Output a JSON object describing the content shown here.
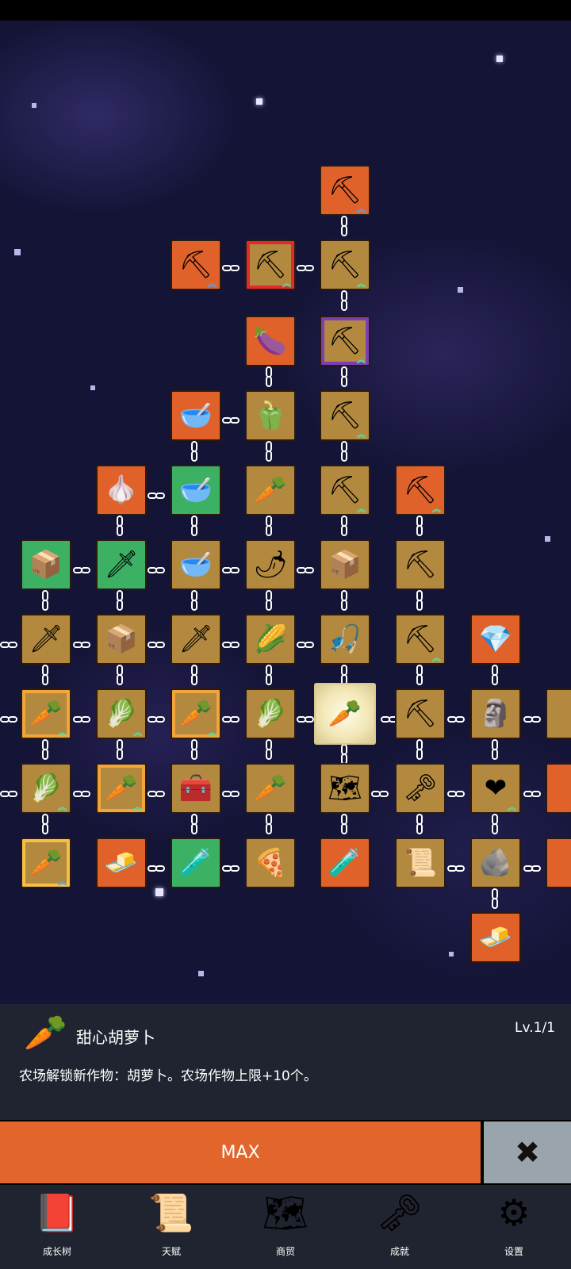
{
  "colors": {
    "space_bg": "#141436",
    "tile_gold": "#b3893f",
    "tile_orange": "#e0622a",
    "tile_green": "#3cb063",
    "panel_bg": "#1f2430",
    "max_button": "#e2652b",
    "close_button": "#9aa4ad"
  },
  "tree": {
    "nodes": [
      {
        "icon": "shovel-icon",
        "glyph": "⛏",
        "tile": "orange",
        "chev": "blue"
      },
      {
        "icon": "shovel-icon",
        "glyph": "⛏",
        "tile": "orange",
        "chev": "blue"
      },
      {
        "icon": "shovel-icon",
        "glyph": "⛏",
        "tile": "gold",
        "chev": "green",
        "frame": "red"
      },
      {
        "icon": "shovel-icon",
        "glyph": "⛏",
        "tile": "gold",
        "chev": "green"
      },
      {
        "icon": "eggplant-icon",
        "glyph": "🍆",
        "tile": "orange"
      },
      {
        "icon": "shovel-icon",
        "glyph": "⛏",
        "tile": "gold",
        "chev": "green",
        "frame": "purple"
      },
      {
        "icon": "bowl-icon",
        "glyph": "🥣",
        "tile": "orange"
      },
      {
        "icon": "pepper-icon",
        "glyph": "🫑",
        "tile": "gold"
      },
      {
        "icon": "shovel-icon",
        "glyph": "⛏",
        "tile": "gold",
        "chev": "green"
      },
      {
        "icon": "garlic-icon",
        "glyph": "🧄",
        "tile": "orange"
      },
      {
        "icon": "bowl-icon",
        "glyph": "🥣",
        "tile": "green"
      },
      {
        "icon": "radish-icon",
        "glyph": "🥕",
        "tile": "gold"
      },
      {
        "icon": "shovel-icon",
        "glyph": "⛏",
        "tile": "gold",
        "chev": "green"
      },
      {
        "icon": "pickaxe-icon",
        "glyph": "⛏",
        "tile": "orange",
        "chev": "green"
      },
      {
        "icon": "crate-icon",
        "glyph": "📦",
        "tile": "green"
      },
      {
        "icon": "sword-icon",
        "glyph": "🗡",
        "tile": "green"
      },
      {
        "icon": "bowl-icon",
        "glyph": "🥣",
        "tile": "gold"
      },
      {
        "icon": "chili-icon",
        "glyph": "🌶",
        "tile": "gold"
      },
      {
        "icon": "crate-icon",
        "glyph": "📦",
        "tile": "gold"
      },
      {
        "icon": "pickaxe-icon",
        "glyph": "⛏",
        "tile": "gold"
      },
      {
        "icon": "sword-icon",
        "glyph": "🗡",
        "tile": "gold"
      },
      {
        "icon": "crate-icon",
        "glyph": "📦",
        "tile": "gold"
      },
      {
        "icon": "sword-icon",
        "glyph": "🗡",
        "tile": "gold"
      },
      {
        "icon": "corn-icon",
        "glyph": "🌽",
        "tile": "gold"
      },
      {
        "icon": "fishing-rod-icon",
        "glyph": "🎣",
        "tile": "gold"
      },
      {
        "icon": "pickaxe-icon",
        "glyph": "⛏",
        "tile": "gold",
        "chev": "green"
      },
      {
        "icon": "crystal-icon",
        "glyph": "💎",
        "tile": "orange"
      },
      {
        "icon": "carrot-icon",
        "glyph": "🥕",
        "tile": "gold",
        "chev": "green",
        "frame": "orange"
      },
      {
        "icon": "cabbage-icon",
        "glyph": "🥬",
        "tile": "gold",
        "chev": "green"
      },
      {
        "icon": "carrot-icon",
        "glyph": "🥕",
        "tile": "gold",
        "chev": "green",
        "frame": "orange"
      },
      {
        "icon": "cabbage-icon",
        "glyph": "🥬",
        "tile": "gold"
      },
      {
        "icon": "carrot-icon",
        "glyph": "🥕",
        "tile": "sel"
      },
      {
        "icon": "pickaxe-icon",
        "glyph": "⛏",
        "tile": "gold"
      },
      {
        "icon": "statue-icon",
        "glyph": "🗿",
        "tile": "gold"
      },
      {
        "icon": "cabbage-icon",
        "glyph": "🥬",
        "tile": "gold",
        "chev": "green"
      },
      {
        "icon": "carrot-icon",
        "glyph": "🥕",
        "tile": "gold",
        "chev": "green",
        "frame": "orange"
      },
      {
        "icon": "chest-icon",
        "glyph": "🧰",
        "tile": "gold"
      },
      {
        "icon": "parsnip-icon",
        "glyph": "🥕",
        "tile": "gold"
      },
      {
        "icon": "map-icon",
        "glyph": "🗺",
        "tile": "gold"
      },
      {
        "icon": "key-icon",
        "glyph": "🗝",
        "tile": "gold"
      },
      {
        "icon": "heart-icon",
        "glyph": "❤",
        "tile": "gold",
        "chev": "green"
      },
      {
        "icon": "carrot-icon",
        "glyph": "🥕",
        "tile": "gold",
        "chev": "blue",
        "frame": "yellow"
      },
      {
        "icon": "gold-bar-icon",
        "glyph": "🧈",
        "tile": "orange"
      },
      {
        "icon": "potion-icon",
        "glyph": "🧪",
        "tile": "green"
      },
      {
        "icon": "pizza-icon",
        "glyph": "🍕",
        "tile": "gold"
      },
      {
        "icon": "potion-icon",
        "glyph": "🧪",
        "tile": "orange"
      },
      {
        "icon": "scroll-icon",
        "glyph": "📜",
        "tile": "gold"
      },
      {
        "icon": "stone-icon",
        "glyph": "🪨",
        "tile": "gold"
      },
      {
        "icon": "gold-bar-icon",
        "glyph": "🧈",
        "tile": "orange"
      }
    ]
  },
  "detail": {
    "icon": "carrot-icon",
    "icon_glyph": "🥕",
    "title": "甜心胡萝卜",
    "level": "Lv.1/1",
    "description": "农场解锁新作物：胡萝卜。农场作物上限+10个。"
  },
  "actions": {
    "max_label": "MAX",
    "close_glyph": "✖"
  },
  "tabs": [
    {
      "label": "成长树",
      "icon": "book-icon",
      "glyph": "📕"
    },
    {
      "label": "天赋",
      "icon": "scroll-icon",
      "glyph": "📜"
    },
    {
      "label": "商贸",
      "icon": "map-icon",
      "glyph": "🗺"
    },
    {
      "label": "成就",
      "icon": "key-icon",
      "glyph": "🗝"
    },
    {
      "label": "设置",
      "icon": "gear-icon",
      "glyph": "⚙"
    }
  ]
}
